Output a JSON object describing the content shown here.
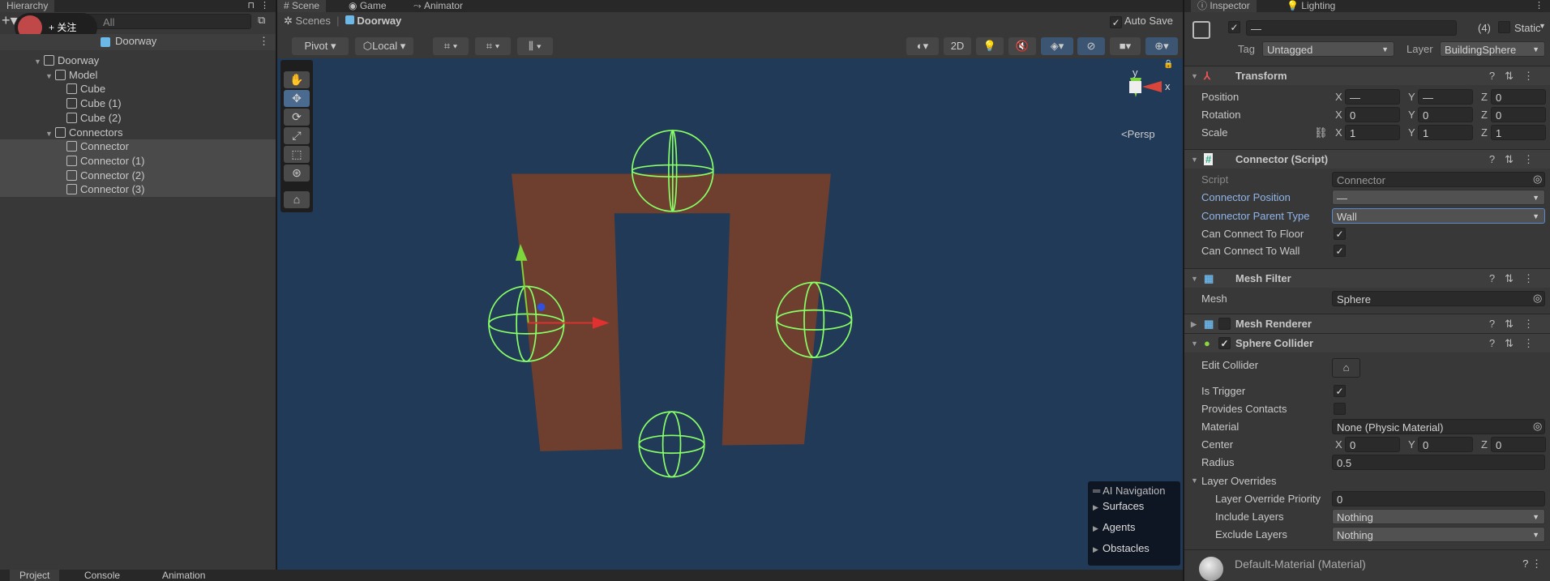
{
  "hierarchy": {
    "tab": "Hierarchy",
    "search_placeholder": "All",
    "scene_name": "Doorway",
    "follow_overlay": "+ 关注",
    "items": [
      {
        "label": "Doorway",
        "depth": 0,
        "expanded": true
      },
      {
        "label": "Model",
        "depth": 1,
        "expanded": true
      },
      {
        "label": "Cube",
        "depth": 2
      },
      {
        "label": "Cube (1)",
        "depth": 2
      },
      {
        "label": "Cube (2)",
        "depth": 2
      },
      {
        "label": "Connectors",
        "depth": 1,
        "expanded": true
      },
      {
        "label": "Connector",
        "depth": 2,
        "selected": true
      },
      {
        "label": "Connector (1)",
        "depth": 2,
        "selected": true
      },
      {
        "label": "Connector (2)",
        "depth": 2,
        "selected": true
      },
      {
        "label": "Connector (3)",
        "depth": 2,
        "selected": true
      }
    ]
  },
  "scene": {
    "tabs": [
      "Scene",
      "Game",
      "Animator"
    ],
    "breadcrumb": [
      "Scenes",
      "Doorway"
    ],
    "auto_save": "Auto Save",
    "auto_save_checked": true,
    "pivot": "Pivot",
    "local": "Local",
    "btn_2d": "2D",
    "persp": "Persp",
    "gizmo_axes": [
      "y",
      "x"
    ],
    "ai_nav": {
      "title": "AI Navigation",
      "items": [
        "Surfaces",
        "Agents",
        "Obstacles"
      ]
    },
    "colors": {
      "background": "#203a57",
      "wall": "#6e3f2e",
      "collider": "#88ff66"
    }
  },
  "bottom_tabs": [
    "Project",
    "Console",
    "Animation"
  ],
  "inspector": {
    "tabs": [
      "Inspector",
      "Lighting"
    ],
    "name_value": "—",
    "count": "(4)",
    "static": "Static",
    "tag_label": "Tag",
    "tag": "Untagged",
    "layer_label": "Layer",
    "layer": "BuildingSphere",
    "transform": {
      "title": "Transform",
      "position": {
        "label": "Position",
        "x": "—",
        "y": "—",
        "z": "0"
      },
      "rotation": {
        "label": "Rotation",
        "x": "0",
        "y": "0",
        "z": "0"
      },
      "scale": {
        "label": "Scale",
        "x": "1",
        "y": "1",
        "z": "1"
      }
    },
    "connector": {
      "title": "Connector (Script)",
      "script_label": "Script",
      "script": "Connector",
      "position_label": "Connector Position",
      "position": "—",
      "parent_type_label": "Connector Parent Type",
      "parent_type": "Wall",
      "floor_label": "Can Connect To Floor",
      "floor": true,
      "wall_label": "Can Connect To Wall",
      "wall": true
    },
    "mesh_filter": {
      "title": "Mesh Filter",
      "mesh_label": "Mesh",
      "mesh": "Sphere"
    },
    "mesh_renderer": {
      "title": "Mesh Renderer",
      "enabled": false
    },
    "sphere_collider": {
      "title": "Sphere Collider",
      "enabled": true,
      "edit_label": "Edit Collider",
      "trigger_label": "Is Trigger",
      "trigger": true,
      "contacts_label": "Provides Contacts",
      "contacts": false,
      "material_label": "Material",
      "material": "None (Physic Material)",
      "center_label": "Center",
      "center": {
        "x": "0",
        "y": "0",
        "z": "0"
      },
      "radius_label": "Radius",
      "radius": "0.5",
      "overrides_label": "Layer Overrides",
      "priority_label": "Layer Override Priority",
      "priority": "0",
      "include_label": "Include Layers",
      "include": "Nothing",
      "exclude_label": "Exclude Layers",
      "exclude": "Nothing"
    },
    "material": "Default-Material (Material)"
  }
}
